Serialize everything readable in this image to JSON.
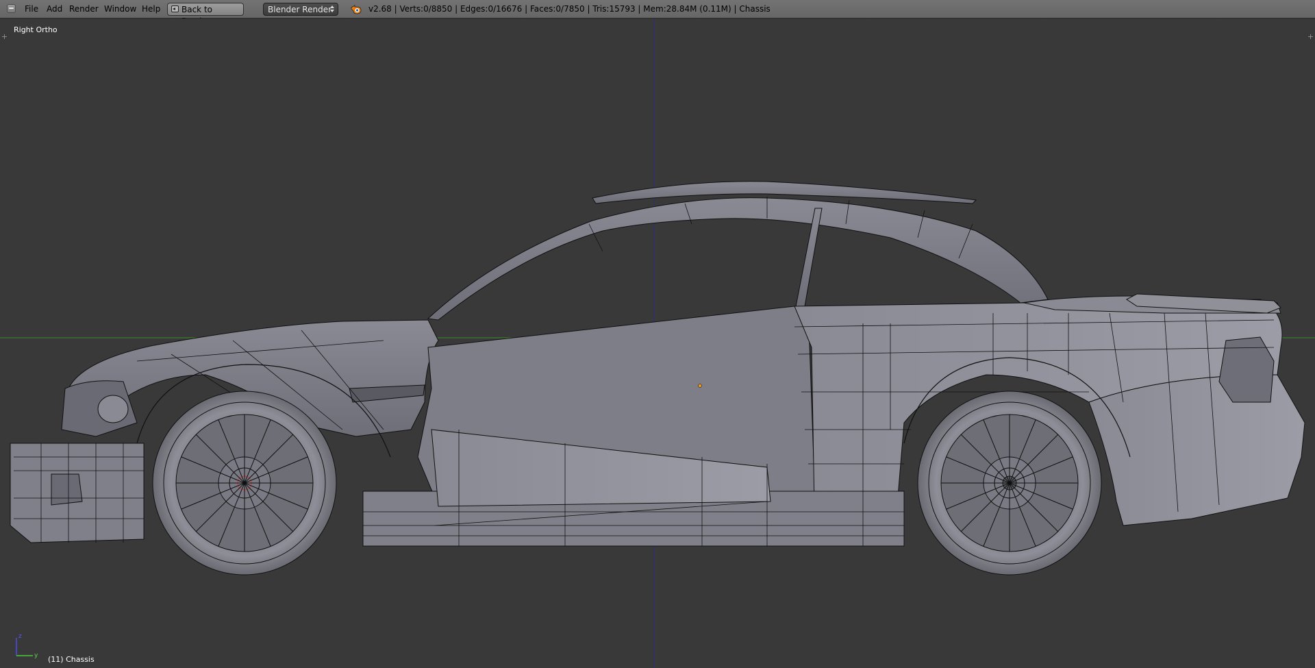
{
  "header": {
    "menu": [
      {
        "label": "File"
      },
      {
        "label": "Add"
      },
      {
        "label": "Render"
      },
      {
        "label": "Window"
      },
      {
        "label": "Help"
      }
    ],
    "back_button_label": "Back to Previous",
    "render_engine": "Blender Render",
    "stats": "v2.68 | Verts:0/8850 | Edges:0/16676 | Faces:0/7850 | Tris:15793 | Mem:28.84M (0.11M) | Chassis"
  },
  "viewport": {
    "view_name": "Right Ortho",
    "object_info": "(11) Chassis",
    "gizmo": {
      "z_label": "z",
      "y_label": "y"
    }
  },
  "icons": {
    "editor_type": "editor-type-icon",
    "back": "back-arrow-icon",
    "render_select": "updown-arrows-icon",
    "blender": "blender-logo-icon",
    "gizmo": "axis-gizmo-icon",
    "origin": "origin-dot-icon",
    "cursor": "3d-cursor-icon"
  },
  "colors": {
    "header_bg": "#6e6e6e",
    "viewport_bg": "#393939",
    "mesh_fill": "#7d7d88",
    "wire": "#101010",
    "x_axis_line": "#3a8a2a",
    "z_axis_line": "#2a2a7a",
    "origin": "#f09a20"
  }
}
